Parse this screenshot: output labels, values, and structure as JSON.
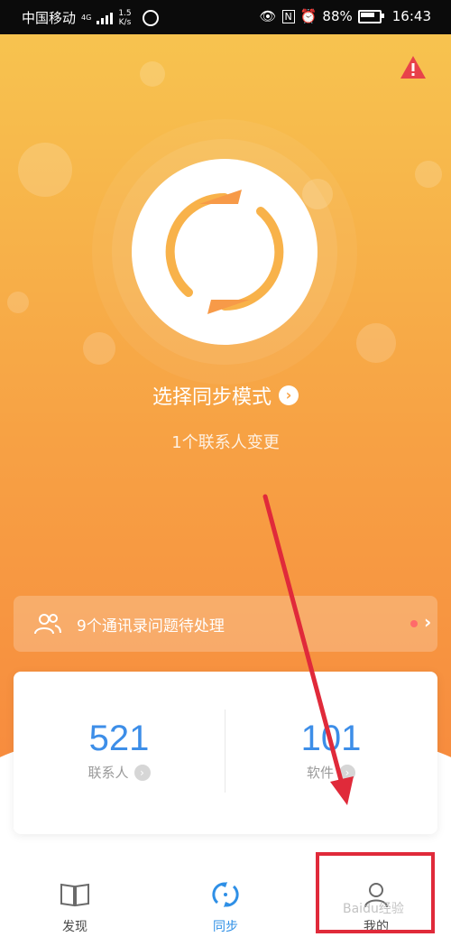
{
  "status_bar": {
    "carrier": "中国移动",
    "network": "4G",
    "speed_value": "1.5",
    "speed_unit": "K/s",
    "battery": "88%",
    "time": "16:43"
  },
  "hero": {
    "warning_icon": "warning-triangle-icon",
    "sync_icon": "sync-arrows-icon",
    "title": "选择同步模式",
    "subtitle": "1个联系人变更",
    "colors": {
      "top": "#f7c34f",
      "bottom": "#f78b3e"
    }
  },
  "alert": {
    "icon": "contacts-icon",
    "text": "9个通讯录问题待处理",
    "dot_color": "#ff6a6a"
  },
  "stats": [
    {
      "value": "521",
      "label": "联系人"
    },
    {
      "value": "101",
      "label": "软件"
    }
  ],
  "nav": [
    {
      "label": "发现",
      "icon": "book-icon",
      "active": false
    },
    {
      "label": "同步",
      "icon": "sync-icon",
      "active": true
    },
    {
      "label": "我的",
      "icon": "person-icon",
      "active": false
    }
  ],
  "watermark": "Baidu经验",
  "accent_color": "#3d8ee8",
  "annotation_color": "#e02a3a"
}
